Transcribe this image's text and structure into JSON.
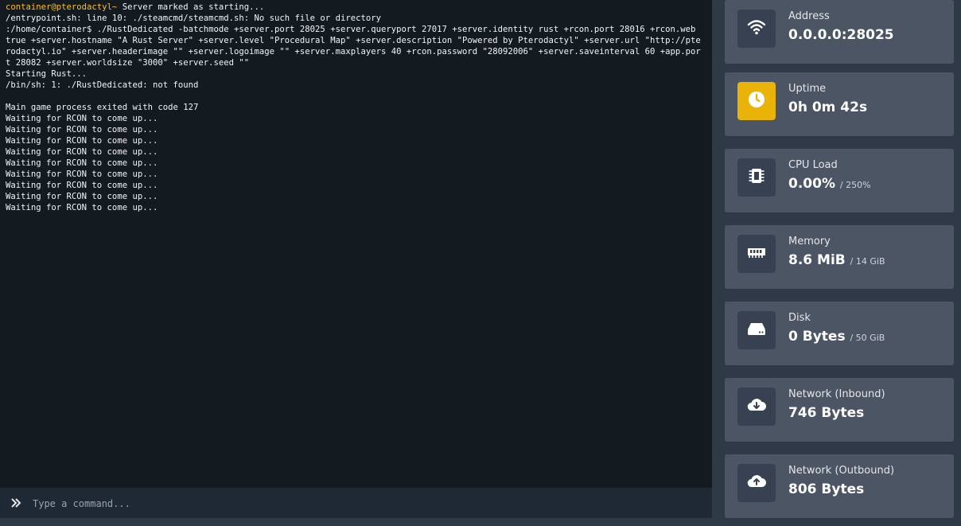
{
  "console": {
    "lines": [
      [
        {
          "text": "container@pterodactyl~",
          "cls": "prompt-user"
        },
        {
          "text": " Server marked as starting..."
        }
      ],
      [
        {
          "text": "/entrypoint.sh: line 10: ./steamcmd/steamcmd.sh: No such file or directory"
        }
      ],
      [
        {
          "text": ":/home/container$ ./RustDedicated -batchmode +server.port 28025 +server.queryport 27017 +server.identity rust +rcon.port 28016 +rcon.web true +server.hostname \"A Rust Server\" +server.level \"Procedural Map\" +server.description \"Powered by Pterodactyl\" +server.url \"http://pterodactyl.io\" +server.headerimage \"\" +server.logoimage \"\" +server.maxplayers 40 +rcon.password \"28092006\" +server.saveinterval 60 +app.port 28082 +server.worldsize \"3000\" +server.seed \"\""
        }
      ],
      [
        {
          "text": "Starting Rust..."
        }
      ],
      [
        {
          "text": "/bin/sh: 1: ./RustDedicated: not found"
        }
      ],
      [
        {
          "text": ""
        }
      ],
      [
        {
          "text": "Main game process exited with code 127"
        }
      ],
      [
        {
          "text": "Waiting for RCON to come up..."
        }
      ],
      [
        {
          "text": "Waiting for RCON to come up..."
        }
      ],
      [
        {
          "text": "Waiting for RCON to come up..."
        }
      ],
      [
        {
          "text": "Waiting for RCON to come up..."
        }
      ],
      [
        {
          "text": "Waiting for RCON to come up..."
        }
      ],
      [
        {
          "text": "Waiting for RCON to come up..."
        }
      ],
      [
        {
          "text": "Waiting for RCON to come up..."
        }
      ],
      [
        {
          "text": "Waiting for RCON to come up..."
        }
      ],
      [
        {
          "text": "Waiting for RCON to come up..."
        }
      ]
    ],
    "colors": {
      "prompt_user": "#fbbf24",
      "text": "#f3f4f6",
      "background": "#131a20"
    }
  },
  "command": {
    "placeholder": "Type a command...",
    "value": "",
    "icon": "double-chevron-right-icon"
  },
  "stats": [
    {
      "name": "address",
      "label": "Address",
      "value": "0.0.0.0:28025",
      "limit": "",
      "icon": "wifi-icon",
      "icon_bg": "#374151"
    },
    {
      "name": "uptime",
      "label": "Uptime",
      "value": "0h 0m 42s",
      "limit": "",
      "icon": "clock-icon",
      "icon_bg": "#eab308"
    },
    {
      "name": "cpu-load",
      "label": "CPU Load",
      "value": "0.00%",
      "limit": "/ 250%",
      "icon": "cpu-chip-icon",
      "icon_bg": "#374151"
    },
    {
      "name": "memory",
      "label": "Memory",
      "value": "8.6 MiB",
      "limit": "/ 14 GiB",
      "icon": "memory-icon",
      "icon_bg": "#374151"
    },
    {
      "name": "disk",
      "label": "Disk",
      "value": "0 Bytes",
      "limit": "/ 50 GiB",
      "icon": "hard-drive-icon",
      "icon_bg": "#374151"
    },
    {
      "name": "network-inbound",
      "label": "Network (Inbound)",
      "value": "746 Bytes",
      "limit": "",
      "icon": "cloud-download-icon",
      "icon_bg": "#374151"
    },
    {
      "name": "network-outbound",
      "label": "Network (Outbound)",
      "value": "806 Bytes",
      "limit": "",
      "icon": "cloud-upload-icon",
      "icon_bg": "#374151"
    }
  ]
}
